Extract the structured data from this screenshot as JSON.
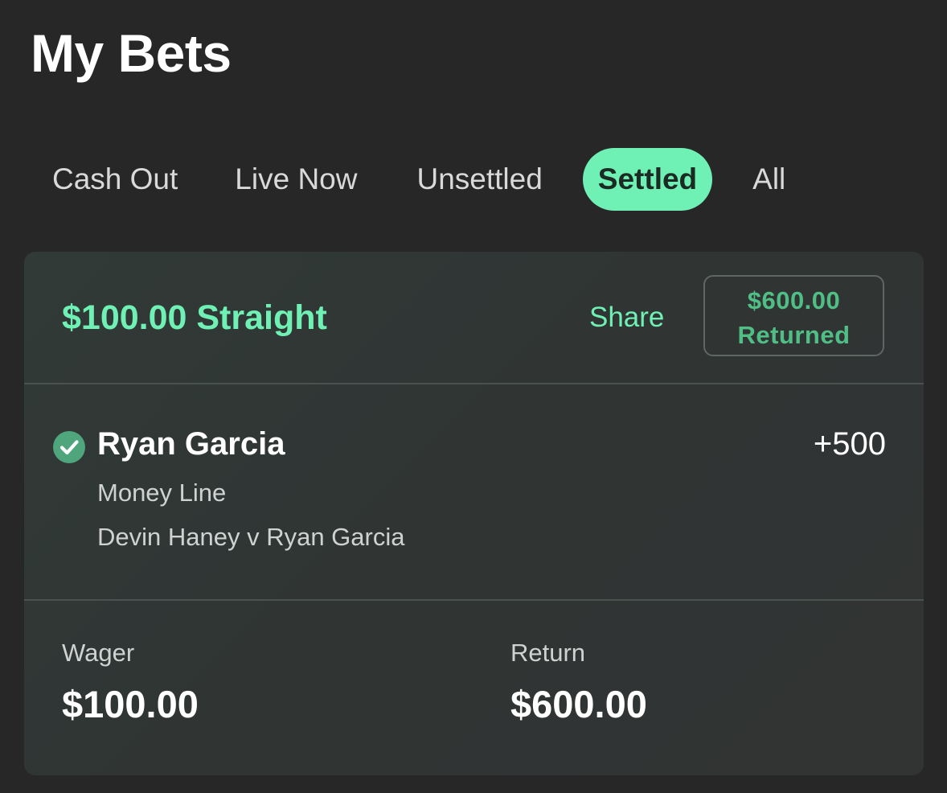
{
  "header": {
    "title": "My Bets"
  },
  "tabs": [
    {
      "label": "Cash Out",
      "active": false
    },
    {
      "label": "Live Now",
      "active": false
    },
    {
      "label": "Unsettled",
      "active": false
    },
    {
      "label": "Settled",
      "active": true
    },
    {
      "label": "All",
      "active": false
    }
  ],
  "bet": {
    "title": "$100.00 Straight",
    "share_label": "Share",
    "returned_amount": "$600.00",
    "returned_label": "Returned",
    "selection": {
      "status_icon": "check-circle-icon",
      "name": "Ryan Garcia",
      "odds": "+500",
      "market": "Money Line",
      "event": "Devin Haney v Ryan Garcia"
    },
    "summary": {
      "wager_label": "Wager",
      "wager_value": "$100.00",
      "return_label": "Return",
      "return_value": "$600.00"
    }
  },
  "colors": {
    "background": "#272727",
    "accent": "#6ff0b4",
    "win_green": "#4fbf86",
    "card": "#313836"
  }
}
